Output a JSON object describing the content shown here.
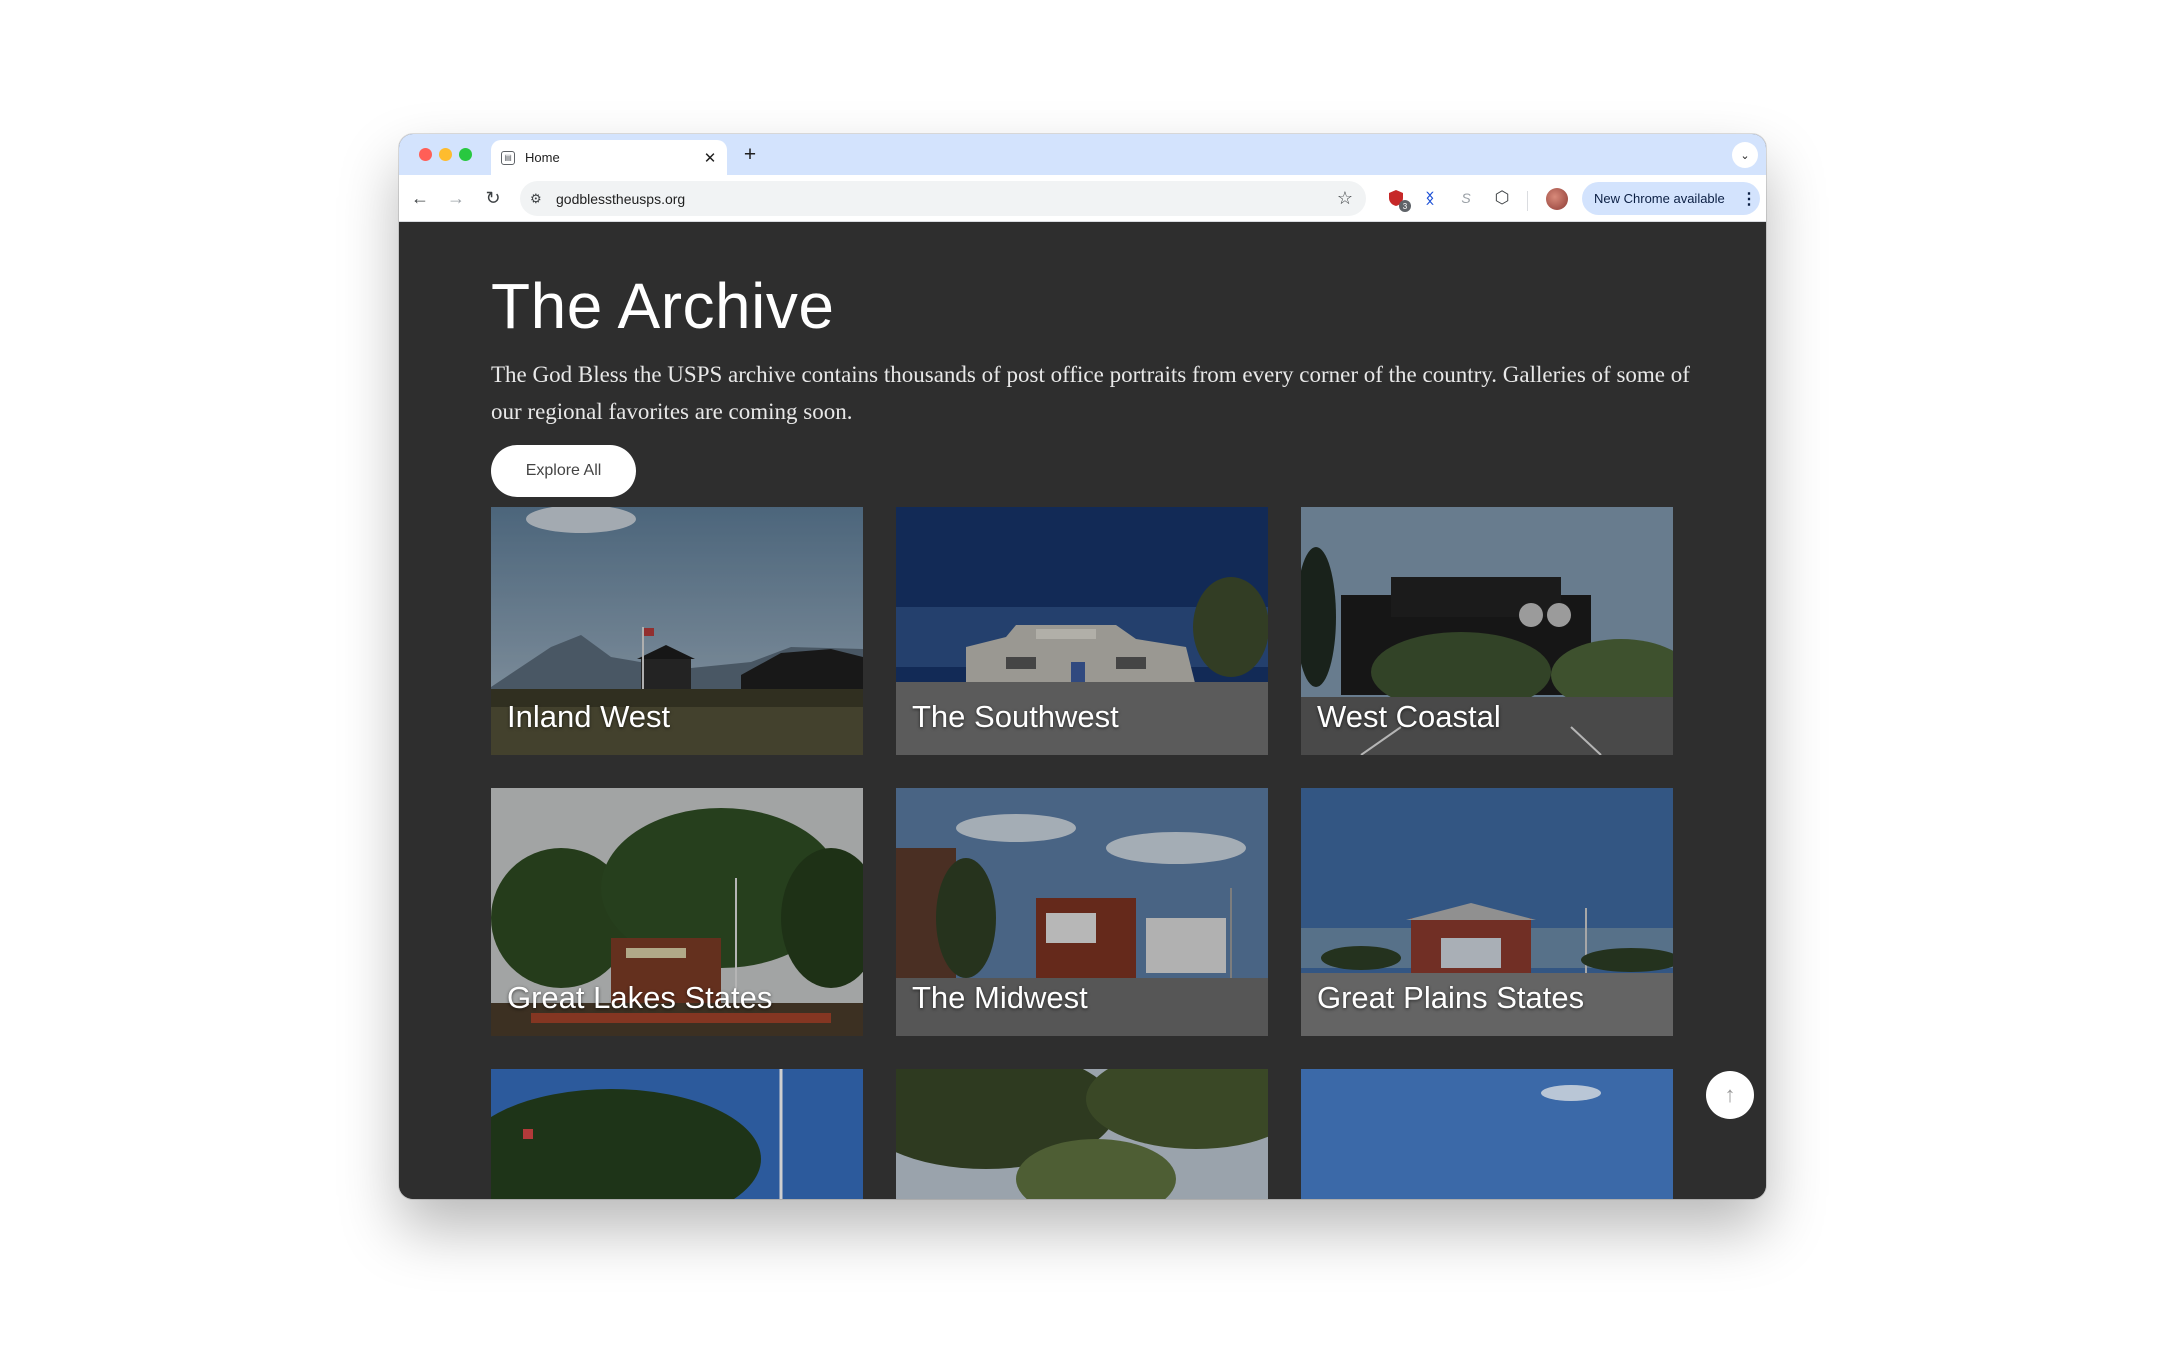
{
  "browser": {
    "tab_title": "Home",
    "tab_close": "✕",
    "new_tab": "+",
    "tab_search": "⌄",
    "back": "←",
    "forward": "→",
    "reload": "↻",
    "site_info": "⚙",
    "url": "godblesstheusps.org",
    "bookmark": "☆",
    "extension_badge": "3",
    "extension_icon_2": "ᛝ",
    "extension_icon_3": "S",
    "puzzle": "⬡",
    "update_label": "New Chrome available",
    "update_menu": "⋮"
  },
  "page": {
    "title": "The Archive",
    "description": "The God Bless the USPS archive contains thousands of post office portraits from every corner of the country. Galleries of some of our regional favorites are coming soon.",
    "explore_label": "Explore All",
    "scroll_top_glyph": "↑"
  },
  "gallery": [
    {
      "label": "Inland West"
    },
    {
      "label": "The Southwest"
    },
    {
      "label": "West Coastal"
    },
    {
      "label": "Great Lakes States"
    },
    {
      "label": "The Midwest"
    },
    {
      "label": "Great Plains States"
    }
  ],
  "icons": {
    "window_controls": [
      "close-dot",
      "minimize-dot",
      "maximize-dot"
    ],
    "tab_favicon": "page-icon",
    "bookmark": "star-icon",
    "extensions": "puzzle-icon",
    "scroll_top": "arrow-up-icon"
  },
  "colors": {
    "page_background": "#2e2e2e",
    "tabstrip": "#d3e3fd",
    "update_pill": "#d3e3fd",
    "button": "#ffffff"
  }
}
